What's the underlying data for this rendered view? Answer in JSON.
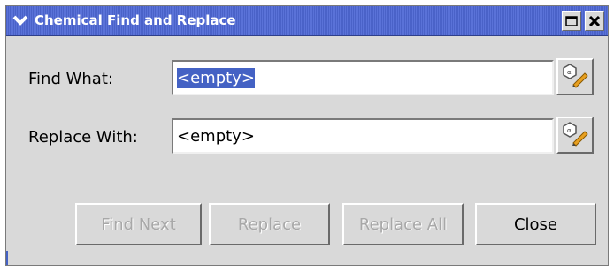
{
  "window": {
    "title": "Chemical Find and Replace"
  },
  "icons": {
    "menu": "chevron-down-icon",
    "maximize": "maximize-icon",
    "close": "close-x-icon",
    "picker": "molecule-edit-icon"
  },
  "colors": {
    "titlebar": "#4a62c8",
    "selection": "#4462c4",
    "dialog_bg": "#d9d9d9",
    "disabled_text": "#a8a8a8"
  },
  "find": {
    "label": "Find What:",
    "value": "<empty>",
    "selected": true
  },
  "replace": {
    "label": "Replace With:",
    "value": "<empty>"
  },
  "buttons": {
    "find_next": "Find Next",
    "replace": "Replace",
    "replace_all": "Replace All",
    "close": "Close"
  }
}
